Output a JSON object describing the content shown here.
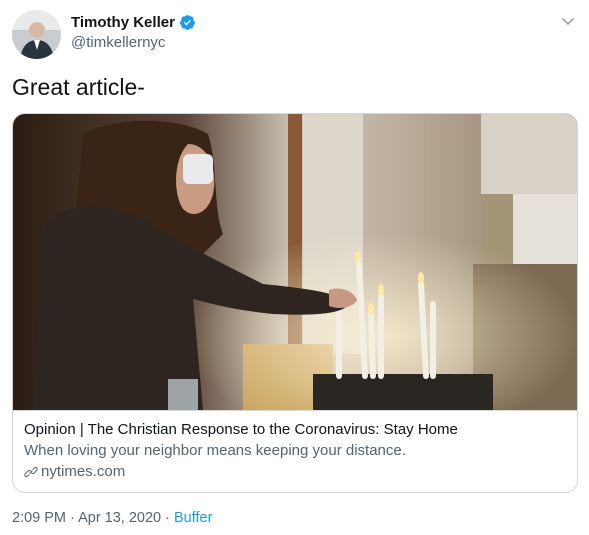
{
  "tweet": {
    "author": {
      "display_name": "Timothy Keller",
      "handle": "@timkellernyc",
      "verified": true
    },
    "text": "Great article-",
    "card": {
      "title": "Opinion | The Christian Response to the Coronavirus: Stay Home",
      "description": "When loving your neighbor means keeping your distance.",
      "domain": "nytimes.com"
    },
    "timestamp": "2:09 PM · Apr 13, 2020",
    "separator": "·",
    "source": "Buffer"
  },
  "colors": {
    "text": "#0f1419",
    "secondary": "#536471",
    "accent": "#1d9bf0",
    "border": "#cfd9de"
  },
  "icons": {
    "verified": "verified-badge-icon",
    "menu": "chevron-down-icon",
    "link": "link-icon"
  }
}
